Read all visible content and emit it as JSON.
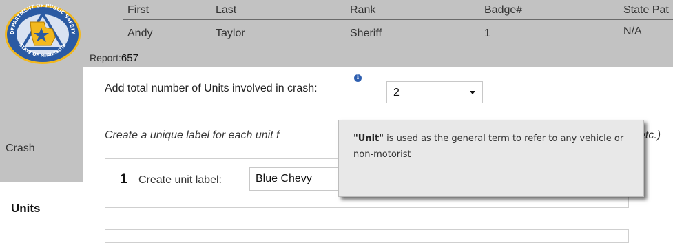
{
  "header": {
    "columns": [
      "First",
      "Last",
      "Rank",
      "Badge#",
      "State Pat"
    ],
    "officer": {
      "first": "Andy",
      "last": "Taylor",
      "rank": "Sheriff",
      "badge": "1",
      "state_patrol": "N/A"
    },
    "report_label": "Report:",
    "report_number": "657",
    "logo": {
      "top_text": "DEPARTMENT OF PUBLIC SAFETY",
      "bottom_text": "STATE OF MINNESOTA"
    }
  },
  "sidebar": {
    "tabs": [
      {
        "label": "Crash"
      },
      {
        "label": "Units"
      }
    ]
  },
  "units_question": "Add total number of Units involved in crash:",
  "units_select": {
    "value": "2"
  },
  "info_icon": {
    "glyph": "i",
    "name": "info-icon"
  },
  "label_instruction": "Create a unique label for each unit f",
  "label_instruction_tail": "etc.)",
  "unit_entry": {
    "number": "1",
    "label": "Create unit label:",
    "value": "Blue Chevy"
  },
  "tooltip": {
    "term": "\"Unit\"",
    "text": " is used as the general term to refer to any vehicle or non-motorist"
  },
  "colors": {
    "header_bg": "#c2c2c2",
    "logo_blue": "#2b5aa3",
    "logo_gold": "#f2b81e",
    "info_icon": "#2e5fb0"
  }
}
